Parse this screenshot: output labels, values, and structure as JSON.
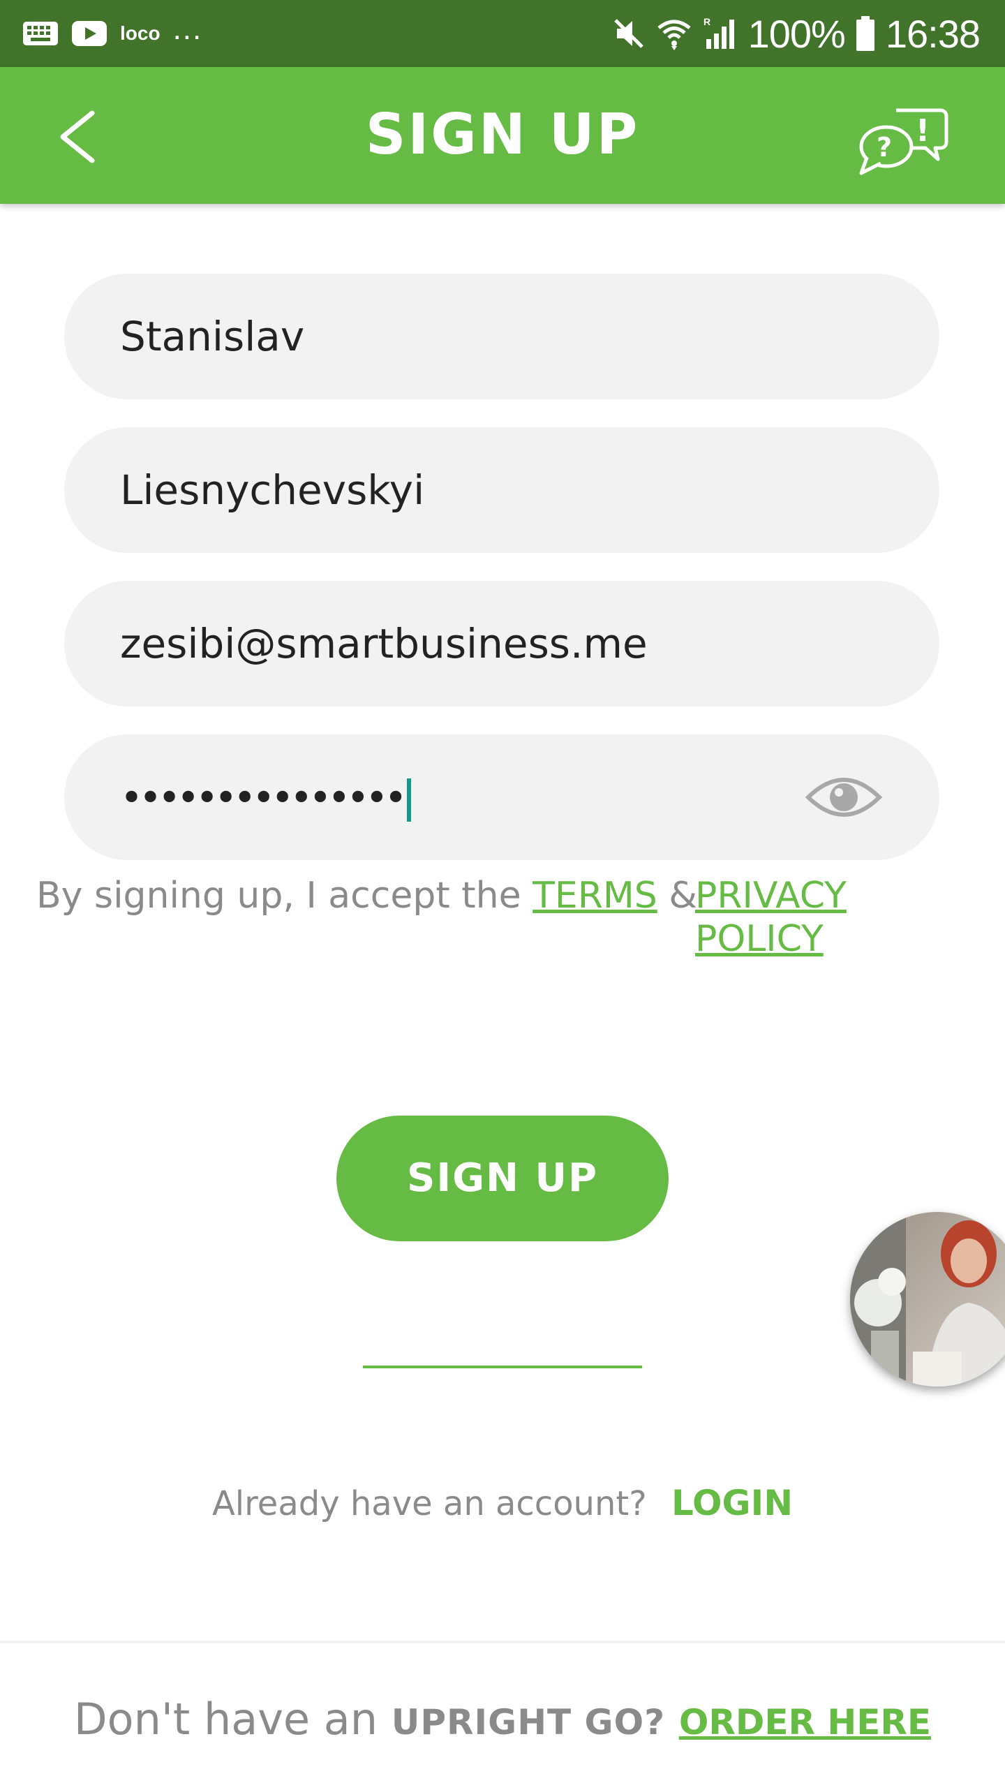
{
  "status_bar": {
    "app_label": "loco",
    "more_indicator": "...",
    "battery_percent": "100%",
    "time": "16:38",
    "icons": [
      "keyboard-icon",
      "youtube-icon",
      "mute-icon",
      "wifi-icon",
      "signal-icon",
      "battery-icon"
    ]
  },
  "header": {
    "title": "SIGN UP",
    "back_icon": "chevron-left-icon",
    "help_icon": "help-chat-icon"
  },
  "form": {
    "first_name": "Stanislav",
    "last_name": "Liesnychevskyi",
    "email": "zesibi@smartbusiness.me",
    "password_masked": "•••••••••••••••",
    "password_toggle_icon": "eye-icon"
  },
  "terms": {
    "prefix": "By signing up, I accept the",
    "terms_link": "TERMS",
    "ampersand": "&",
    "privacy_line1": "PRIVACY",
    "privacy_line2": "POLICY"
  },
  "signup_button": "SIGN UP",
  "login": {
    "prompt": "Already have an account?",
    "link": "LOGIN"
  },
  "footer": {
    "prefix": "Don't have an",
    "brand": "UPRIGHT GO?",
    "link": "ORDER HERE"
  },
  "colors": {
    "status_bar": "#41732b",
    "brand_green": "#66bb44",
    "field_bg": "#f1f2f1",
    "caret": "#13998c",
    "muted_text": "#8a8a8a"
  }
}
